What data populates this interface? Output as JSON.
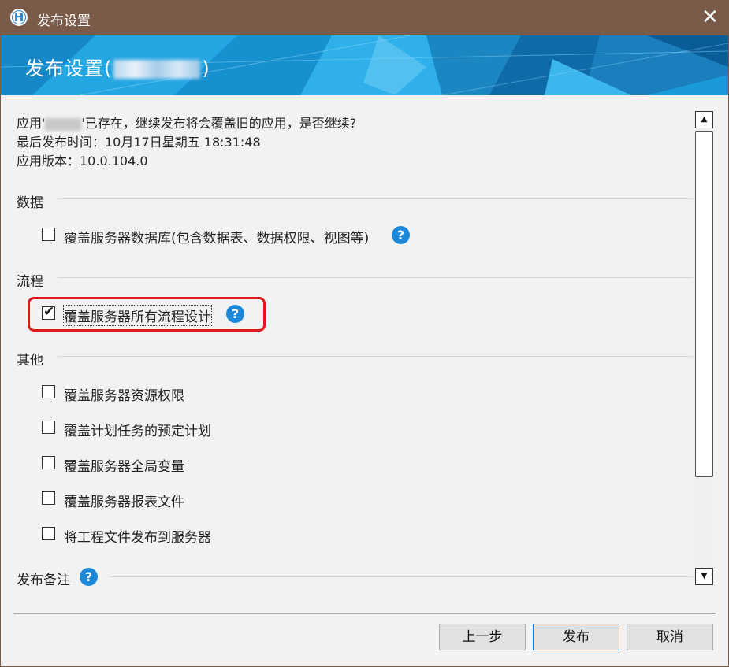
{
  "window": {
    "title": "发布设置",
    "icon_letter": "H",
    "close_glyph": "✕"
  },
  "banner": {
    "title_prefix": "发布设置(",
    "title_suffix": ")"
  },
  "info": {
    "line1_prefix": "应用'",
    "line1_suffix": "'已存在，继续发布将会覆盖旧的应用，是否继续?",
    "line2": "最后发布时间：10月17日星期五 18:31:48",
    "line3": "应用版本：10.0.104.0"
  },
  "sections": {
    "data": {
      "title": "数据",
      "options": [
        {
          "label": "覆盖服务器数据库(包含数据表、数据权限、视图等)",
          "checked": false
        }
      ]
    },
    "workflow": {
      "title": "流程",
      "options": [
        {
          "label": "覆盖服务器所有流程设计",
          "checked": true
        }
      ]
    },
    "other": {
      "title": "其他",
      "options": [
        {
          "label": "覆盖服务器资源权限",
          "checked": false
        },
        {
          "label": "覆盖计划任务的预定计划",
          "checked": false
        },
        {
          "label": "覆盖服务器全局变量",
          "checked": false
        },
        {
          "label": "覆盖服务器报表文件",
          "checked": false
        },
        {
          "label": "将工程文件发布到服务器",
          "checked": false
        }
      ]
    },
    "notes": {
      "title": "发布备注"
    }
  },
  "help_glyph": "?",
  "scrollbar": {
    "up_glyph": "▲",
    "down_glyph": "▼"
  },
  "buttons": {
    "prev": "上一步",
    "publish": "发布",
    "cancel": "取消"
  },
  "colors": {
    "titlebar": "#7a5a48",
    "banner": "#1a9ad9",
    "highlight": "#e01a1a",
    "help_icon": "#1e88d8"
  }
}
